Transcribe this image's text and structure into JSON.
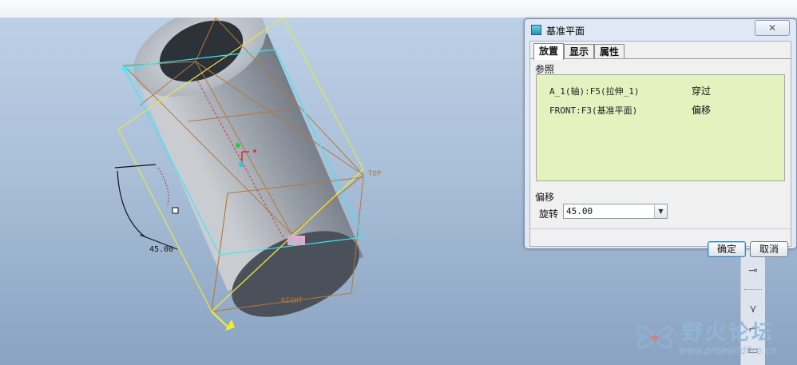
{
  "dialog": {
    "title": "基准平面",
    "close_icon": "close-icon",
    "tabs": [
      "放置",
      "显示",
      "属性"
    ],
    "references_label": "参照",
    "references": [
      {
        "reference": "A_1(轴):F5(拉伸_1)",
        "type": "穿过"
      },
      {
        "reference": "FRONT:F3(基准平面)",
        "type": "偏移"
      }
    ],
    "offset_label": "偏移",
    "rotation_label": "旋转",
    "rotation_value": "45.00",
    "ok_label": "确定",
    "cancel_label": "取消"
  },
  "viewport": {
    "labels": {
      "front": "FRONT",
      "top": "TOP",
      "right": "RIGHT",
      "axis": "A_1",
      "dimension": "45.00"
    },
    "colors": {
      "background_top": "#bcd0e6",
      "background_bottom": "#8aa3c2",
      "datum_edge": "#b5783a",
      "preview_plane": "#e9e640",
      "selected": "#3ee7f0",
      "axis": "#d13a3a"
    }
  },
  "watermark": {
    "text": "野火论坛",
    "url": "www.proewildfire.cn"
  }
}
